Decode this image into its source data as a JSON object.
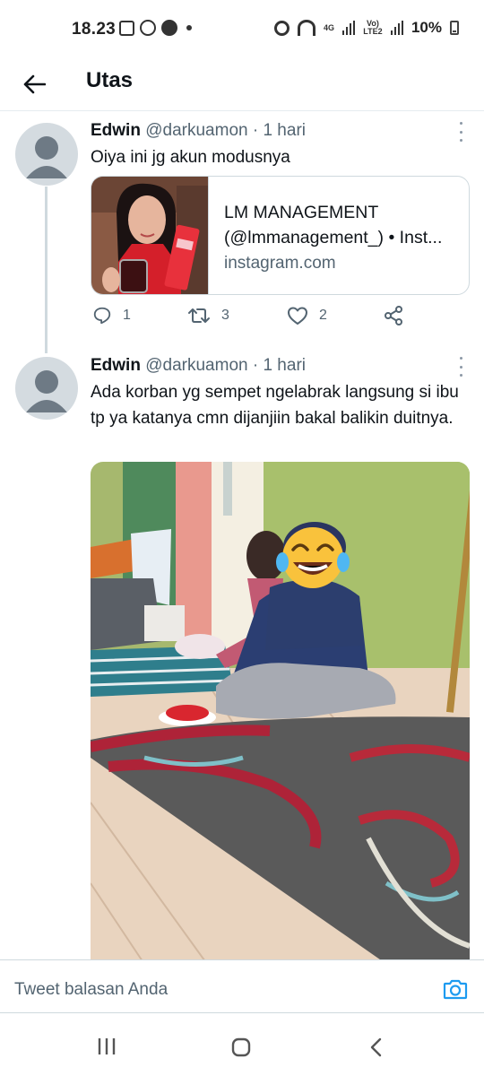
{
  "status_bar": {
    "time": "18.23",
    "battery": "10%",
    "network_top": "4G",
    "network_label": "Vo) LTE2"
  },
  "header": {
    "title": "Utas"
  },
  "tweets": [
    {
      "name": "Edwin",
      "handle": "@darkuamon",
      "time": "· 1 hari",
      "text": "Oiya ini jg akun modusnya",
      "card": {
        "title_line1": "LM MANAGEMENT",
        "title_line2": "(@lmmanagement_) • Inst...",
        "domain": "instagram.com"
      },
      "replies": "1",
      "retweets": "3",
      "likes": "2"
    },
    {
      "name": "Edwin",
      "handle": "@darkuamon",
      "time": "· 1 hari",
      "text": "Ada korban yg sempet ngelabrak langsung si ibu tp ya katanya cmn dijanjiin bakal balikin duitnya."
    }
  ],
  "reply_bar": {
    "placeholder": "Tweet balasan Anda"
  },
  "icons": {
    "back": "arrow-left-icon",
    "more": "more-vertical-icon",
    "reply": "comment-icon",
    "retweet": "retweet-icon",
    "like": "heart-icon",
    "share": "share-icon",
    "camera": "camera-icon",
    "emoji_overlay": "laughing-tears-emoji"
  },
  "colors": {
    "accent": "#1d9bf0",
    "text_primary": "#0f1419",
    "text_secondary": "#536471",
    "border": "#cfd9de"
  }
}
